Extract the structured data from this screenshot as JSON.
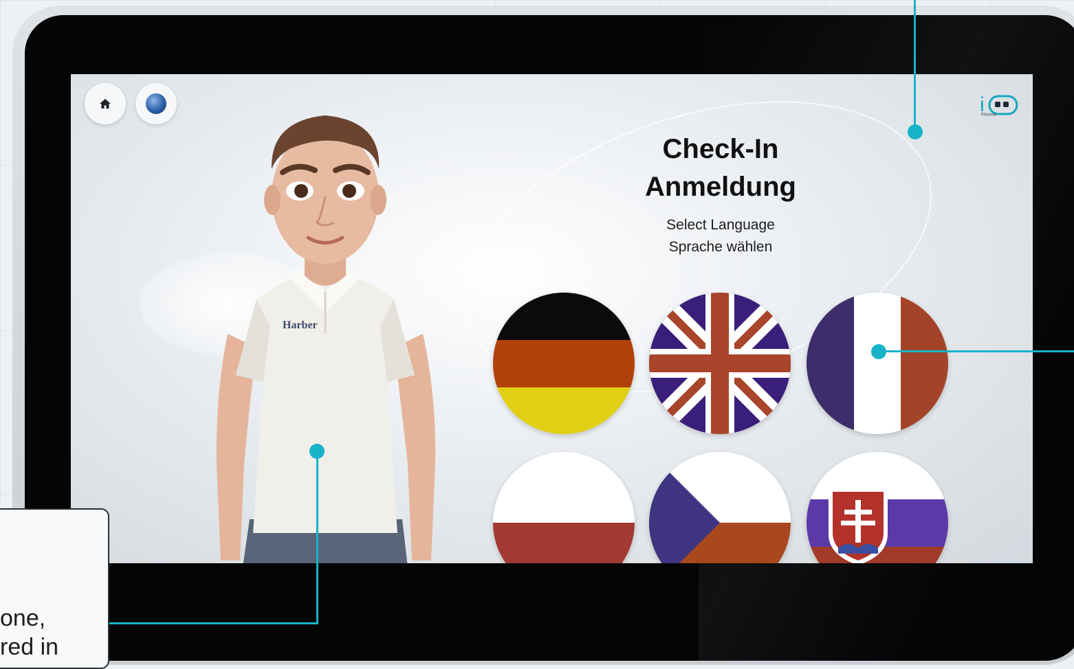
{
  "screen": {
    "title_line1": "Check-In",
    "title_line2": "Anmeldung",
    "subtitle_line1": "Select Language",
    "subtitle_line2": "Sprache wählen"
  },
  "nav": {
    "home_icon": "home-icon",
    "globe_icon": "globe-icon"
  },
  "logo": {
    "glyph": "i",
    "caption": "Fhrmts"
  },
  "avatar": {
    "shirt_brand": "Harber"
  },
  "languages": [
    {
      "name": "German",
      "flag": "de"
    },
    {
      "name": "English",
      "flag": "uk"
    },
    {
      "name": "French",
      "flag": "fr"
    },
    {
      "name": "Polish",
      "flag": "pl"
    },
    {
      "name": "Czech",
      "flag": "cz"
    },
    {
      "name": "Slovak",
      "flag": "sk"
    }
  ],
  "annotation": {
    "text_line1": "one,",
    "text_line2": "red in"
  },
  "colors": {
    "accent": "#18b3c9",
    "bezel": "#050506"
  }
}
